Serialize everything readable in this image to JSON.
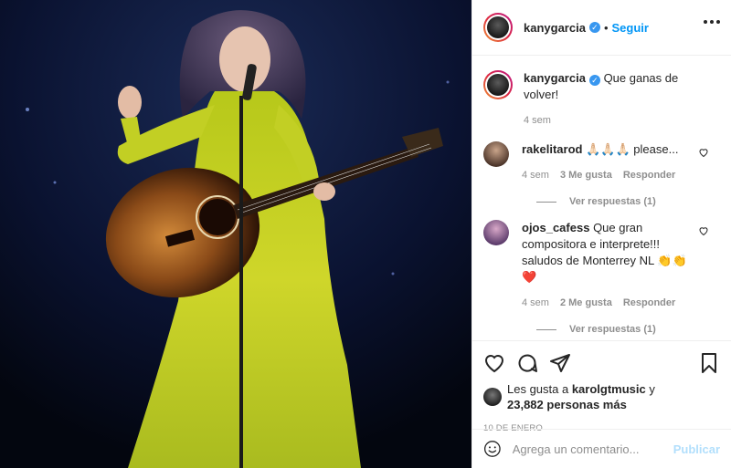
{
  "post": {
    "username": "kanygarcia",
    "follow_label": "Seguir",
    "dot": "•",
    "caption": "Que ganas de volver!",
    "caption_time": "4 sem"
  },
  "comments": [
    {
      "username": "rakelitarod",
      "text": "🙏🏻🙏🏻🙏🏻 please...",
      "time": "4 sem",
      "likes": "3 Me gusta",
      "reply": "Responder",
      "view_replies": "Ver respuestas (1)"
    },
    {
      "username": "ojos_cafess",
      "text": "Que gran compositora e interprete!!! saludos de Monterrey NL 👏👏 ❤️",
      "time": "4 sem",
      "likes": "2 Me gusta",
      "reply": "Responder",
      "view_replies": "Ver respuestas (1)"
    }
  ],
  "likes": {
    "prefix": "Les gusta a ",
    "user": "karolgtmusic",
    "middle": " y",
    "count": "23,882 personas más"
  },
  "date": "10 DE ENERO",
  "add_comment": {
    "placeholder": "Agrega un comentario...",
    "publish_label": "Publicar"
  },
  "colors": {
    "accent": "#0095f6",
    "publish_disabled": "#b2dffc",
    "muted": "#8e8e8e",
    "dress": "#c9d320"
  }
}
